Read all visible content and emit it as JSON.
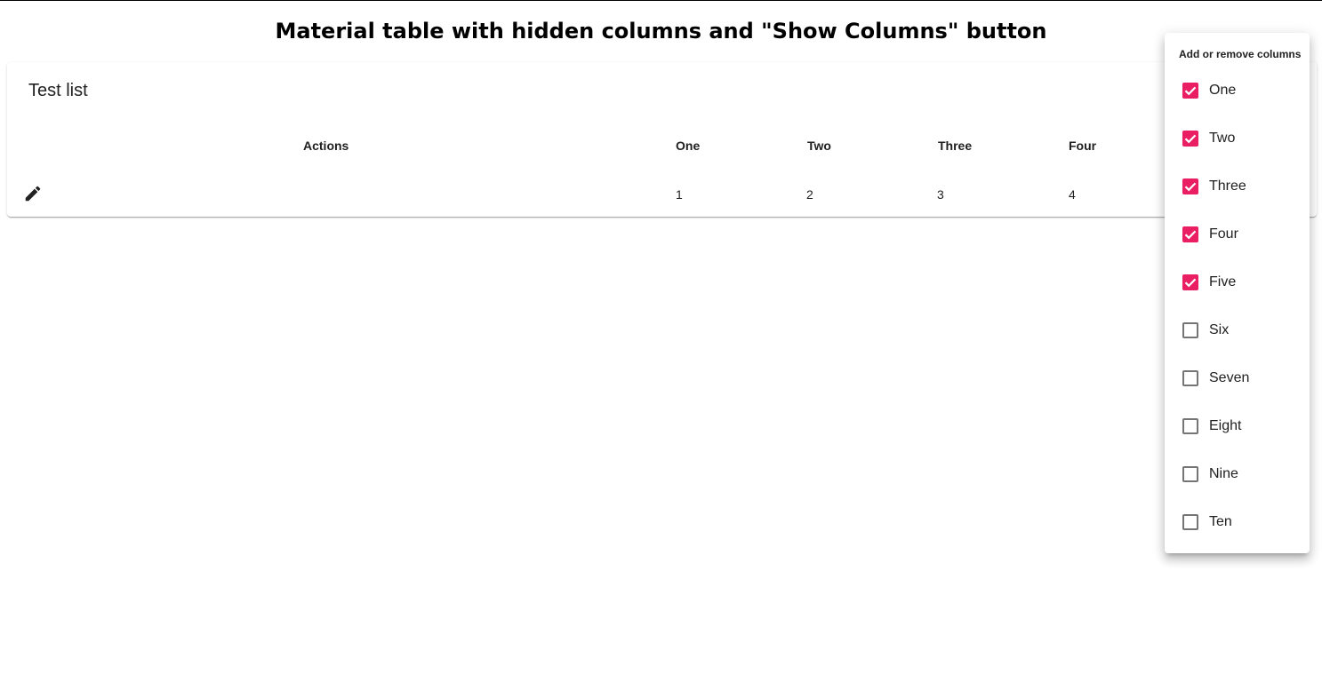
{
  "page": {
    "heading": "Material table with hidden columns and \"Show Columns\" button"
  },
  "table": {
    "title": "Test list",
    "headers": [
      "Actions",
      "One",
      "Two",
      "Three",
      "Four"
    ],
    "rows": [
      {
        "action_icon": "edit-icon",
        "cells": [
          "1",
          "2",
          "3",
          "4"
        ]
      }
    ]
  },
  "column_menu": {
    "header": "Add or remove columns",
    "accent_color": "#e91e63",
    "items": [
      {
        "label": "One",
        "checked": true
      },
      {
        "label": "Two",
        "checked": true
      },
      {
        "label": "Three",
        "checked": true
      },
      {
        "label": "Four",
        "checked": true
      },
      {
        "label": "Five",
        "checked": true
      },
      {
        "label": "Six",
        "checked": false
      },
      {
        "label": "Seven",
        "checked": false
      },
      {
        "label": "Eight",
        "checked": false
      },
      {
        "label": "Nine",
        "checked": false
      },
      {
        "label": "Ten",
        "checked": false
      }
    ]
  }
}
